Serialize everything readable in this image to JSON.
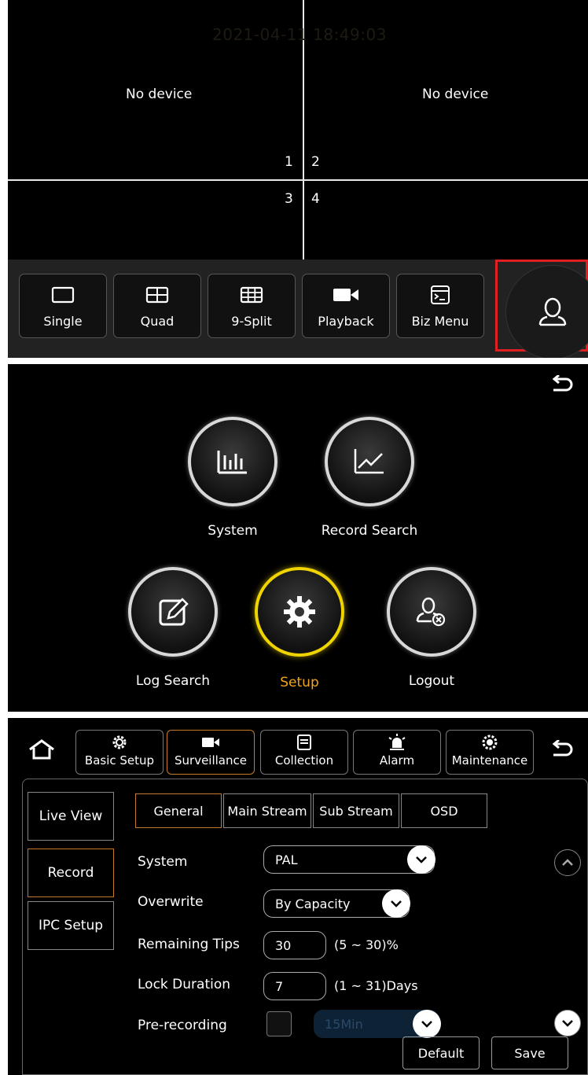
{
  "live_view": {
    "timestamp": "2021-04-11 18:49:03",
    "channels": [
      {
        "number": "1",
        "status": "No device"
      },
      {
        "number": "2",
        "status": "No device"
      },
      {
        "number": "3",
        "status": ""
      },
      {
        "number": "4",
        "status": ""
      }
    ],
    "toolbar": {
      "single_label": "Single",
      "quad_label": "Quad",
      "nine_split_label": "9-Split",
      "playback_label": "Playback",
      "biz_menu_label": "Biz Menu"
    },
    "highlight_color": "#e02020"
  },
  "main_menu": {
    "items": {
      "system": "System",
      "record_search": "Record Search",
      "log_search": "Log Search",
      "setup": "Setup",
      "logout": "Logout"
    },
    "active_item": "Setup",
    "active_color": "#f2a51a"
  },
  "setup": {
    "top_tabs": {
      "basic_setup": "Basic Setup",
      "surveillance": "Surveillance",
      "collection": "Collection",
      "alarm": "Alarm",
      "maintenance": "Maintenance"
    },
    "active_top_tab": "Surveillance",
    "side_menu": {
      "live_view": "Live View",
      "record": "Record",
      "ipc_setup": "IPC Setup"
    },
    "active_side": "Record",
    "sub_tabs": {
      "general": "General",
      "main_stream": "Main Stream",
      "sub_stream": "Sub Stream",
      "osd": "OSD"
    },
    "active_sub_tab": "General",
    "fields": {
      "system_label": "System",
      "system_value": "PAL",
      "overwrite_label": "Overwrite",
      "overwrite_value": "By Capacity",
      "remaining_tips_label": "Remaining Tips",
      "remaining_tips_value": "30",
      "remaining_tips_range": "(5 ~ 30)%",
      "lock_duration_label": "Lock Duration",
      "lock_duration_value": "7",
      "lock_duration_range": "(1 ~ 31)Days",
      "prerecording_label": "Pre-recording",
      "prerecording_enabled": false,
      "prerecording_value": "15Min"
    },
    "buttons": {
      "default": "Default",
      "save": "Save"
    },
    "accent_color": "#c57b2b"
  }
}
